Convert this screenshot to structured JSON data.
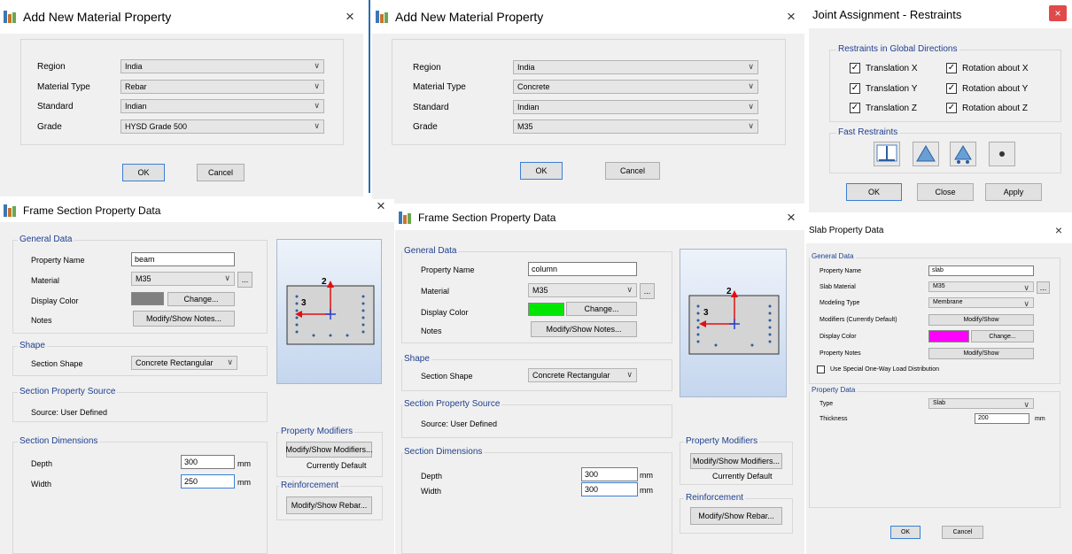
{
  "mat1": {
    "title": "Add New Material Property",
    "labels": [
      "Region",
      "Material Type",
      "Standard",
      "Grade"
    ],
    "values": [
      "India",
      "Rebar",
      "Indian",
      "HYSD Grade 500"
    ],
    "ok": "OK",
    "cancel": "Cancel"
  },
  "mat2": {
    "title": "Add New Material Property",
    "labels": [
      "Region",
      "Material Type",
      "Standard",
      "Grade"
    ],
    "values": [
      "India",
      "Concrete",
      "Indian",
      "M35"
    ],
    "ok": "OK",
    "cancel": "Cancel"
  },
  "joint": {
    "title": "Joint Assignment - Restraints",
    "close_glyph": "×",
    "group": "Restraints in Global Directions",
    "checks": [
      "Translation X",
      "Rotation about X",
      "Translation Y",
      "Rotation about Y",
      "Translation Z",
      "Rotation about Z"
    ],
    "fast": "Fast Restraints",
    "ok": "OK",
    "close": "Close",
    "apply": "Apply"
  },
  "frame1": {
    "title": "Frame Section Property Data",
    "general": "General Data",
    "name_label": "Property Name",
    "name_value": "beam",
    "material_label": "Material",
    "material_value": "M35",
    "color_label": "Display Color",
    "color": "#808080",
    "change": "Change...",
    "notes_label": "Notes",
    "notes_btn": "Modify/Show Notes...",
    "shape": "Shape",
    "shape_label": "Section Shape",
    "shape_value": "Concrete Rectangular",
    "source": "Section Property Source",
    "source_text": "Source:  User Defined",
    "dims": "Section Dimensions",
    "depth_label": "Depth",
    "depth_value": "300",
    "width_label": "Width",
    "width_value": "250",
    "unit": "mm",
    "modifiers": "Property Modifiers",
    "mod_btn": "Modify/Show Modifiers...",
    "mod_state": "Currently Default",
    "reinf": "Reinforcement",
    "rebar_btn": "Modify/Show Rebar...",
    "ellipsis": "...",
    "axis2": "2",
    "axis3": "3"
  },
  "frame2": {
    "title": "Frame Section Property Data",
    "general": "General Data",
    "name_label": "Property Name",
    "name_value": "column",
    "material_label": "Material",
    "material_value": "M35",
    "color_label": "Display Color",
    "color": "#00e600",
    "change": "Change...",
    "notes_label": "Notes",
    "notes_btn": "Modify/Show Notes...",
    "shape": "Shape",
    "shape_label": "Section Shape",
    "shape_value": "Concrete Rectangular",
    "source": "Section Property Source",
    "source_text": "Source:  User Defined",
    "dims": "Section Dimensions",
    "depth_label": "Depth",
    "depth_value": "300",
    "width_label": "Width",
    "width_value": "300",
    "unit": "mm",
    "modifiers": "Property Modifiers",
    "mod_btn": "Modify/Show Modifiers...",
    "mod_state": "Currently Default",
    "reinf": "Reinforcement",
    "rebar_btn": "Modify/Show Rebar...",
    "ellipsis": "...",
    "axis2": "2",
    "axis3": "3"
  },
  "slab": {
    "title": "Slab Property Data",
    "general": "General Data",
    "name_label": "Property Name",
    "name_value": "slab",
    "material_label": "Slab Material",
    "material_value": "M35",
    "modeling_label": "Modeling Type",
    "modeling_value": "Membrane",
    "modifiers_label": "Modifiers (Currently Default)",
    "modifiers_btn": "Modify/Show",
    "color_label": "Display Color",
    "color": "#ff00ff",
    "change": "Change...",
    "notes_label": "Property Notes",
    "notes_btn": "Modify/Show",
    "special": "Use Special One-Way Load Distribution",
    "prop": "Property Data",
    "type_label": "Type",
    "type_value": "Slab",
    "thick_label": "Thickness",
    "thick_value": "200",
    "unit": "mm",
    "ok": "OK",
    "cancel": "Cancel",
    "ellipsis": "..."
  },
  "icons": {
    "close": "×",
    "check": "✓"
  }
}
